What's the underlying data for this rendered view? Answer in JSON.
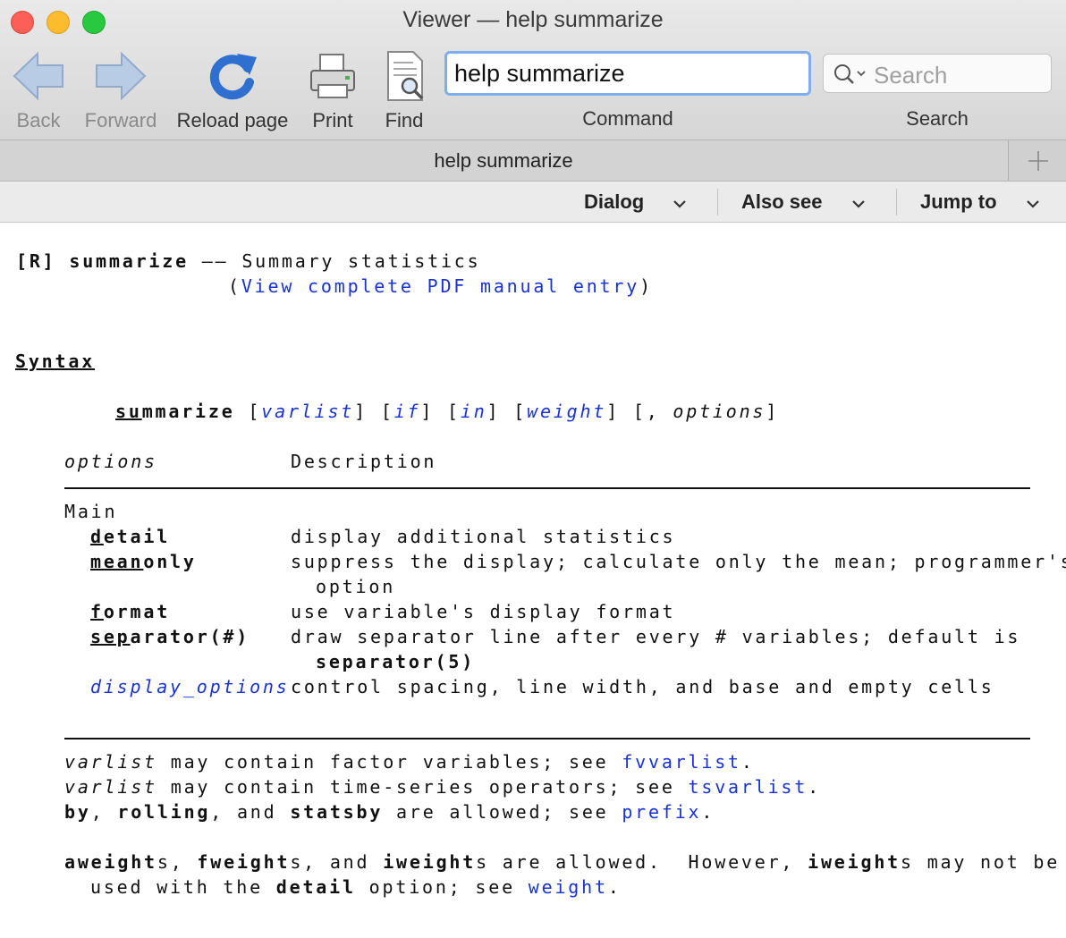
{
  "window": {
    "title": "Viewer — help summarize"
  },
  "toolbar": {
    "back_label": "Back",
    "forward_label": "Forward",
    "reload_label": "Reload page",
    "print_label": "Print",
    "find_label": "Find",
    "command_value": "help summarize",
    "command_label": "Command",
    "search_placeholder": "Search",
    "search_label": "Search"
  },
  "tab": {
    "title": "help summarize",
    "add_icon": "plus-icon"
  },
  "actions": {
    "dialog": "Dialog",
    "also_see": "Also see",
    "jump_to": "Jump to"
  },
  "colors": {
    "link": "#1932d4",
    "selection": "#b3d1f7",
    "focus_ring": "#7eaef0"
  },
  "doc": {
    "header": {
      "tag": "[R]",
      "cmd": "summarize",
      "dash": "——",
      "desc": "Summary statistics",
      "paren_open": "(",
      "pdf_link": "View complete PDF manual entry",
      "paren_close": ")"
    },
    "syntax_heading": "Syntax",
    "syntax": {
      "cmd_abbrev": "su",
      "cmd_rest": "mmarize",
      "b1": "[",
      "varlist": "varlist",
      "b2": "] [",
      "if": "if",
      "b3": "] [",
      "in": "in",
      "b4": "] [",
      "weight": "weight",
      "b5": "] [,",
      "options": "options",
      "b6": "]"
    },
    "table": {
      "col_options": "options",
      "col_desc": "Description",
      "group": "Main",
      "rows": [
        {
          "abbr": "d",
          "rest": "etail",
          "desc": "display additional statistics"
        },
        {
          "abbr": "mean",
          "rest": "only",
          "desc": "suppress the display; calculate only the mean; programmer's",
          "desc2": "option"
        },
        {
          "abbr": "f",
          "rest": "ormat",
          "desc": "use variable's display format"
        },
        {
          "abbr": "sep",
          "rest": "arator(#)",
          "desc": "draw separator line after every # variables; default is",
          "desc2": "separator(5)"
        },
        {
          "link": "display_options",
          "desc": "control spacing, line width, and base and empty cells"
        }
      ]
    },
    "notes": {
      "n1_var": "varlist",
      "n1_text": " may contain factor variables; see ",
      "n1_link": "fvvarlist",
      "n1_end": ".",
      "n2_var": "varlist",
      "n2_text": " may contain time-series operators; see ",
      "n2_link": "tsvarlist",
      "n2_end": ".",
      "n3_by": "by",
      "n3_c1": ", ",
      "n3_rolling": "rolling",
      "n3_c2": ", and ",
      "n3_statsby": "statsby",
      "n3_text": " are allowed; see ",
      "n3_link": "prefix",
      "n3_end": "."
    },
    "weights": {
      "aw": "aweight",
      "t1": "s, ",
      "fw": "fweight",
      "t2": "s, and ",
      "iw": "iweight",
      "t3": "s are allowed.  However, ",
      "iw2": "iweight",
      "t4": "s may not be",
      "l2_a": "used with the ",
      "detail": "detail",
      "l2_b": " option; see ",
      "link": "weight",
      "end": "."
    }
  }
}
